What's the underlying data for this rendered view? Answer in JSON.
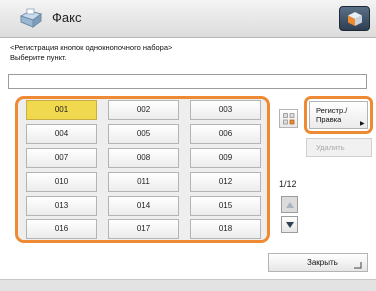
{
  "header": {
    "title": "Факс",
    "app_icon": "fax-icon",
    "menu_icon": "menu-cube-icon"
  },
  "instructions": {
    "line1": "<Регистрация кнопок однокнопочного набора>",
    "line2": "Выберите пункт."
  },
  "name_field": {
    "value": ""
  },
  "keys": [
    "001",
    "002",
    "003",
    "004",
    "005",
    "006",
    "007",
    "008",
    "009",
    "010",
    "011",
    "012",
    "013",
    "014",
    "015",
    "016",
    "017",
    "018"
  ],
  "selected_key": "001",
  "page_indicator": "1/12",
  "side_buttons": {
    "register_line1": "Регистр./",
    "register_line2": "Правка",
    "delete": "Удалить"
  },
  "close_button": "Закрыть",
  "colors": {
    "accent_orange": "#ee8a33",
    "selected_key": "#f1d94f",
    "menu_button": "#2e3e52"
  }
}
